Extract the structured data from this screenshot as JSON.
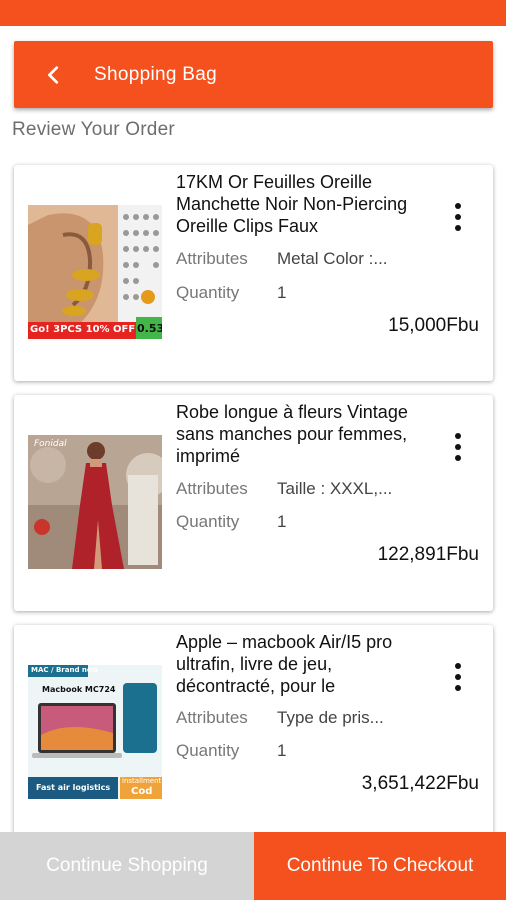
{
  "header": {
    "title": "Shopping Bag",
    "back_icon": "chevron-left-icon"
  },
  "section_title": "Review Your Order",
  "labels": {
    "attributes": "Attributes",
    "quantity": "Quantity"
  },
  "items": [
    {
      "name": "17KM Or Feuilles Oreille Manchette Noir Non-Piercing Oreille Clips Faux",
      "attributes": "Metal Color :...",
      "quantity": "1",
      "price": "15,000Fbu",
      "image_text": {
        "promo": "Go! 3PCS 10% OFF",
        "badge": "0.53"
      }
    },
    {
      "name": "Robe longue à fleurs Vintage sans manches pour femmes, imprimé",
      "attributes": "Taille : XXXL,...",
      "quantity": "1",
      "price": "122,891Fbu",
      "image_text": {
        "caption": "Fonidal"
      }
    },
    {
      "name": "Apple – macbook Air/I5 pro ultrafin, livre de jeu, décontracté, pour le",
      "attributes": "Type de pris...",
      "quantity": "1",
      "price": "3,651,422Fbu",
      "image_text": {
        "tag": "MAC / Brand new",
        "model": "Macbook MC724",
        "logistics": "Fast air logistics",
        "installment": "installment",
        "cod": "Cod"
      }
    }
  ],
  "buttons": {
    "continue_shopping": "Continue Shopping",
    "checkout": "Continue To Checkout"
  },
  "colors": {
    "accent": "#f4511e",
    "disabled": "#d4d4d4"
  }
}
